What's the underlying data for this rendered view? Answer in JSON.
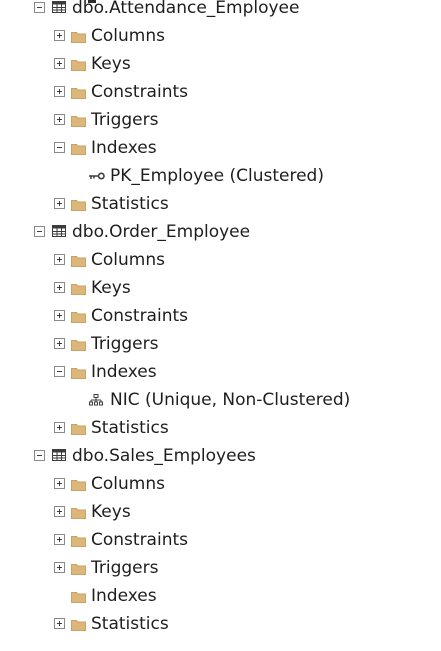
{
  "tables": [
    {
      "name": "dbo.Attendance_Employee",
      "expanded": true,
      "folders": [
        {
          "label": "Columns",
          "state": "collapsed"
        },
        {
          "label": "Keys",
          "state": "collapsed"
        },
        {
          "label": "Constraints",
          "state": "collapsed"
        },
        {
          "label": "Triggers",
          "state": "collapsed"
        },
        {
          "label": "Indexes",
          "state": "expanded"
        },
        {
          "label": "Statistics",
          "state": "collapsed"
        }
      ],
      "index": {
        "label": "PK_Employee (Clustered)",
        "icon": "primary-key-icon"
      }
    },
    {
      "name": "dbo.Order_Employee",
      "expanded": true,
      "folders": [
        {
          "label": "Columns",
          "state": "collapsed"
        },
        {
          "label": "Keys",
          "state": "collapsed"
        },
        {
          "label": "Constraints",
          "state": "collapsed"
        },
        {
          "label": "Triggers",
          "state": "collapsed"
        },
        {
          "label": "Indexes",
          "state": "expanded"
        },
        {
          "label": "Statistics",
          "state": "collapsed"
        }
      ],
      "index": {
        "label": "NIC (Unique, Non-Clustered)",
        "icon": "nonclustered-index-icon"
      }
    },
    {
      "name": "dbo.Sales_Employees",
      "expanded": true,
      "folders": [
        {
          "label": "Columns",
          "state": "collapsed"
        },
        {
          "label": "Keys",
          "state": "collapsed"
        },
        {
          "label": "Constraints",
          "state": "collapsed"
        },
        {
          "label": "Triggers",
          "state": "collapsed"
        },
        {
          "label": "Indexes",
          "state": "empty"
        },
        {
          "label": "Statistics",
          "state": "collapsed"
        }
      ]
    }
  ],
  "colors": {
    "text": "#1e1e1e",
    "folder": "#dcb67a",
    "toggle_border": "#8a8a8a"
  }
}
